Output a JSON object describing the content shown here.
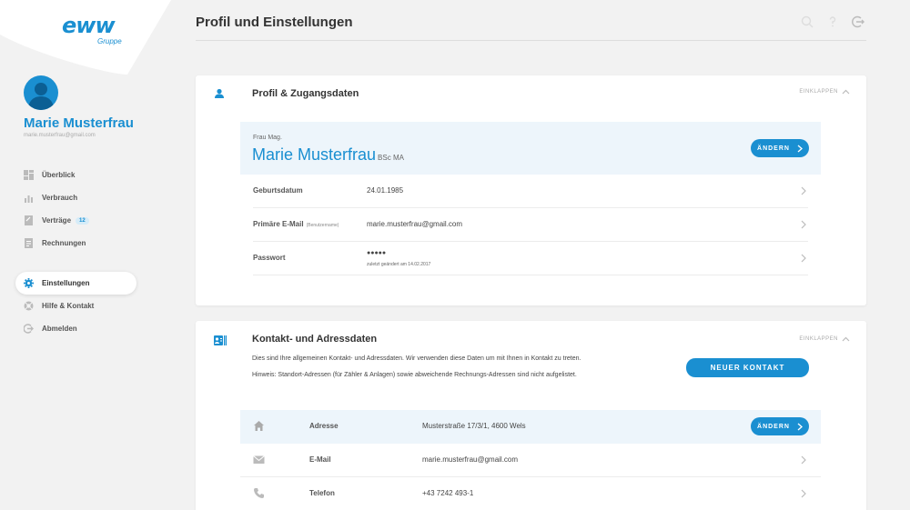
{
  "brand": {
    "logo": "eww",
    "sub": "Gruppe"
  },
  "user": {
    "name": "Marie Musterfrau",
    "email": "marie.musterfrau@gmail.com"
  },
  "nav": {
    "primary": [
      {
        "label": "Überblick",
        "icon": "dashboard-icon"
      },
      {
        "label": "Verbrauch",
        "icon": "chart-icon"
      },
      {
        "label": "Verträge",
        "icon": "contract-icon",
        "badge": "12"
      },
      {
        "label": "Rechnungen",
        "icon": "invoice-icon"
      }
    ],
    "secondary": [
      {
        "label": "Einstellungen",
        "icon": "gear-icon",
        "active": true
      },
      {
        "label": "Hilfe & Kontakt",
        "icon": "help-icon"
      },
      {
        "label": "Abmelden",
        "icon": "logout-icon"
      }
    ]
  },
  "page": {
    "title": "Profil und Einstellungen"
  },
  "profile": {
    "title": "Profil & Zugangsdaten",
    "collapse_label": "EINKLAPPEN",
    "salutation": "Frau Mag.",
    "name": "Marie Musterfrau",
    "name_suffix": "BSc MA",
    "change_label": "ÄNDERN",
    "rows": [
      {
        "label": "Geburtsdatum",
        "hint": "",
        "value": "24.01.1985",
        "sub": ""
      },
      {
        "label": "Primäre E-Mail",
        "hint": "(Benutzername)",
        "value": "marie.musterfrau@gmail.com",
        "sub": ""
      },
      {
        "label": "Passwort",
        "hint": "",
        "value": "●●●●●",
        "sub": "zuletzt geändert am 14.02.2017"
      }
    ]
  },
  "contact": {
    "title": "Kontakt- und Adressdaten",
    "collapse_label": "EINKLAPPEN",
    "desc1": "Dies sind Ihre allgemeinen Kontakt- und Adressdaten. Wir verwenden diese Daten um mit Ihnen in Kontakt zu treten.",
    "desc2": "Hinweis: Standort-Adressen (für Zähler & Anlagen) sowie abweichende Rechnungs-Adressen sind nicht aufgelistet.",
    "new_contact_label": "NEUER KONTAKT",
    "change_label": "ÄNDERN",
    "rows": [
      {
        "label": "Adresse",
        "value": "Musterstraße 17/3/1, 4600 Wels",
        "icon": "home-icon"
      },
      {
        "label": "E-Mail",
        "value": "marie.musterfrau@gmail.com",
        "icon": "mail-icon"
      },
      {
        "label": "Telefon",
        "value": "+43 7242 493-1",
        "icon": "phone-icon"
      }
    ]
  }
}
